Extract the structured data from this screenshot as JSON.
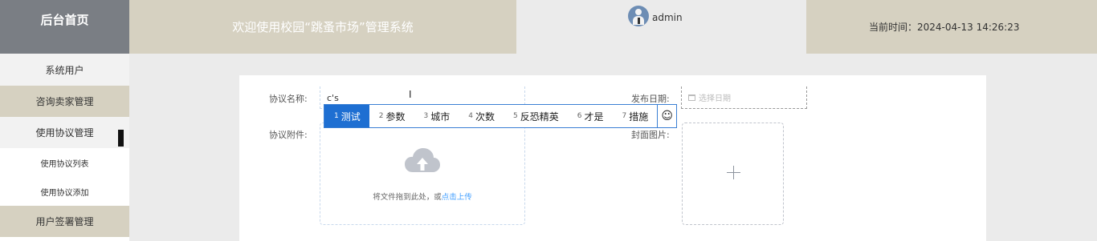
{
  "header": {
    "brand": "后台首页",
    "welcome": "欢迎使用校园“跳蚤市场”管理系统",
    "username": "admin",
    "time_label": "当前时间：",
    "time_value": "2024-04-13 14:26:23"
  },
  "sidebar": {
    "items": [
      {
        "label": "系统用户"
      },
      {
        "label": "咨询卖家管理"
      },
      {
        "label": "使用协议管理"
      },
      {
        "label": "使用协议列表"
      },
      {
        "label": "使用协议添加"
      },
      {
        "label": "用户签署管理"
      }
    ]
  },
  "form": {
    "name_label": "协议名称:",
    "name_value": "c's",
    "date_label": "发布日期:",
    "date_placeholder": "选择日期",
    "attachment_label": "协议附件:",
    "cover_label": "封面图片:",
    "upload_hint": "将文件拖到此处，或",
    "upload_link": "点击上传"
  },
  "ime": {
    "candidates": [
      {
        "num": "1",
        "text": "测试"
      },
      {
        "num": "2",
        "text": "参数"
      },
      {
        "num": "3",
        "text": "城市"
      },
      {
        "num": "4",
        "text": "次数"
      },
      {
        "num": "5",
        "text": "反恐精英"
      },
      {
        "num": "6",
        "text": "才是"
      },
      {
        "num": "7",
        "text": "措施"
      }
    ],
    "emoji": "☺"
  },
  "colors": {
    "accent": "#d6d1c1",
    "brand_bg": "#7a7e84",
    "ime_selected": "#1e6fd2",
    "link": "#409eff"
  }
}
